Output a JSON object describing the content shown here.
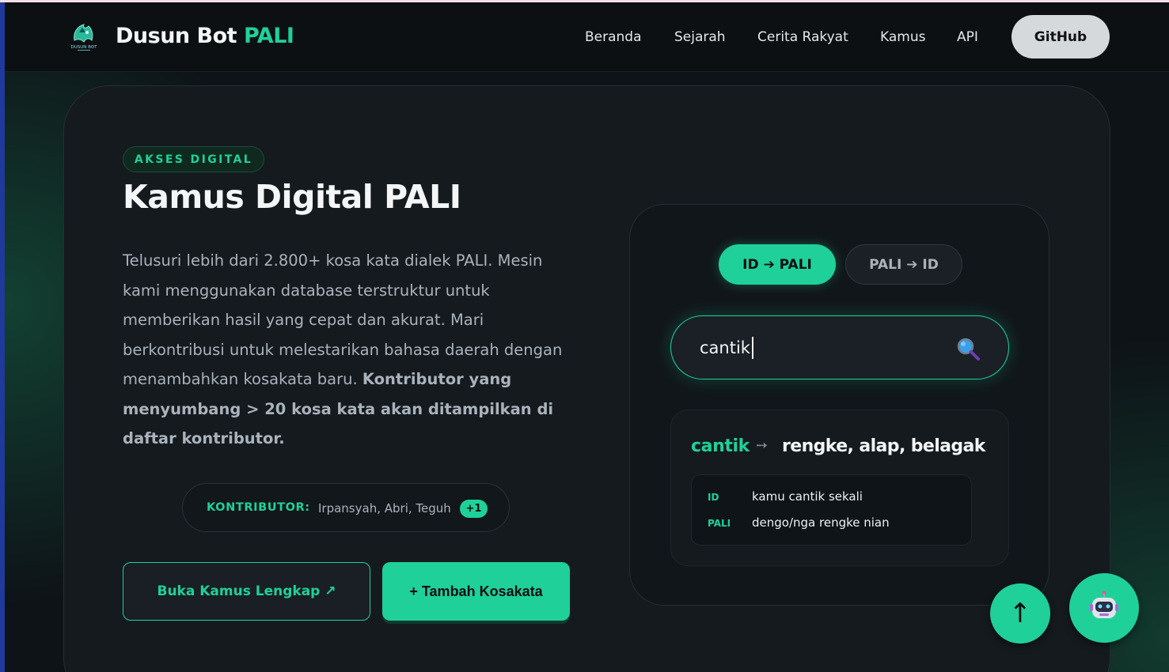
{
  "nav": {
    "brand_main": "Dusun Bot",
    "brand_accent": "PALI",
    "logo_text": "DUSUN BOT",
    "links": [
      "Beranda",
      "Sejarah",
      "Cerita Rakyat",
      "Kamus",
      "API"
    ],
    "github_label": "GitHub"
  },
  "hero": {
    "badge": "AKSES DIGITAL",
    "title": "Kamus Digital PALI",
    "desc_plain": "Telusuri lebih dari 2.800+ kosa kata dialek PALI. Mesin kami menggunakan database terstruktur untuk memberikan hasil yang cepat dan akurat. Mari berkontribusi untuk melestarikan bahasa daerah dengan menambahkan kosakata baru.",
    "desc_bold": "Kontributor yang menyumbang > 20 kosa kata akan ditampilkan di daftar kontributor.",
    "contrib_label": "KONTRIBUTOR:",
    "contrib_names": "Irpansyah, Abri, Teguh",
    "contrib_more": "+1",
    "btn_open": "Buka Kamus Lengkap ↗",
    "btn_add": "+ Tambah Kosakata"
  },
  "dictionary": {
    "tab_active": "ID ➔ PALI",
    "tab_inactive": "PALI ➔ ID",
    "search_value": "cantik",
    "search_icon": "search-icon",
    "result": {
      "word": "cantik",
      "arrow": "➙",
      "translation": "rengke, alap, belagak",
      "example_id_tag": "ID",
      "example_id": "kamu cantik sekali",
      "example_pali_tag": "PALI",
      "example_pali": "dengo/nga rengke nian"
    }
  },
  "fab": {
    "scroll_top": "↑",
    "chatbot_icon": "robot-icon"
  },
  "colors": {
    "accent": "#1fd198",
    "background": "#0e1317",
    "card": "#151a1f"
  }
}
